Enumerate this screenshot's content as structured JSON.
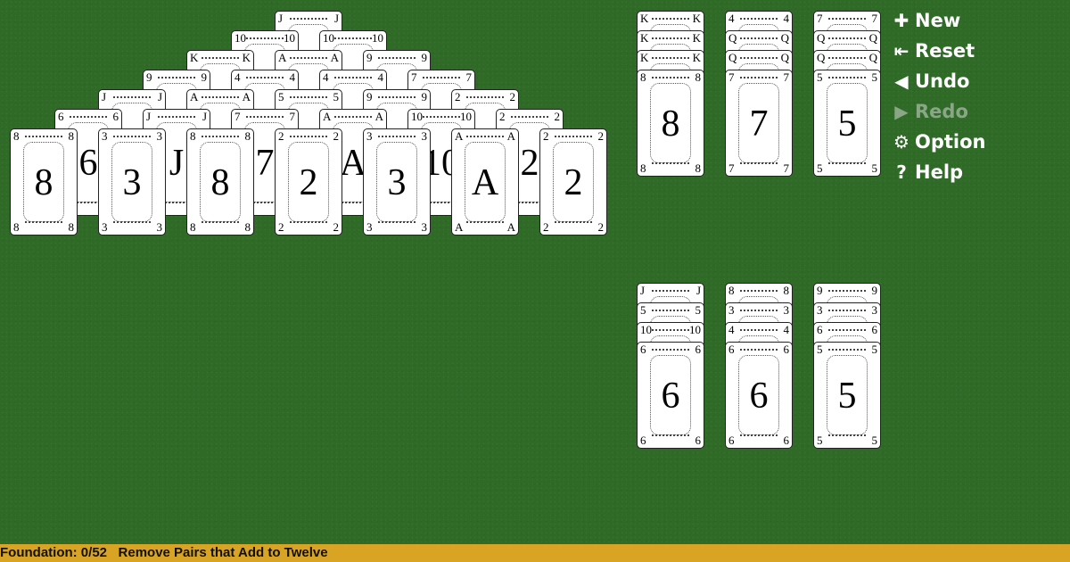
{
  "colors": {
    "felt": "#2f6a27",
    "status_bar": "#d9a423",
    "menu_text": "#ffffff",
    "menu_disabled": "#8aa687"
  },
  "pyramid": {
    "rows": [
      [
        "J"
      ],
      [
        "10",
        "10"
      ],
      [
        "K",
        "A",
        "9"
      ],
      [
        "9",
        "4",
        "4",
        "7"
      ],
      [
        "J",
        "A",
        "5",
        "9",
        "2"
      ],
      [
        "6",
        "J",
        "7",
        "A",
        "10",
        "2"
      ],
      [
        "8",
        "3",
        "8",
        "2",
        "3",
        "A",
        "2"
      ]
    ]
  },
  "top_piles": [
    {
      "cards": [
        "K",
        "K",
        "K",
        "8"
      ]
    },
    {
      "cards": [
        "4",
        "Q",
        "Q",
        "7"
      ]
    },
    {
      "cards": [
        "7",
        "Q",
        "Q",
        "5"
      ]
    }
  ],
  "bottom_piles": [
    {
      "cards": [
        "J",
        "5",
        "10",
        "6"
      ]
    },
    {
      "cards": [
        "8",
        "3",
        "4",
        "6"
      ]
    },
    {
      "cards": [
        "9",
        "3",
        "6",
        "5"
      ]
    }
  ],
  "menu": [
    {
      "name": "new",
      "icon": "plus-icon",
      "glyph": "✚",
      "label": "New",
      "enabled": true
    },
    {
      "name": "reset",
      "icon": "reset-icon",
      "glyph": "⇤",
      "label": "Reset",
      "enabled": true
    },
    {
      "name": "undo",
      "icon": "undo-icon",
      "glyph": "◀",
      "label": "Undo",
      "enabled": true
    },
    {
      "name": "redo",
      "icon": "redo-icon",
      "glyph": "▶",
      "label": "Redo",
      "enabled": false
    },
    {
      "name": "option",
      "icon": "gear-icon",
      "glyph": "⚙",
      "label": "Option",
      "enabled": true
    },
    {
      "name": "help",
      "icon": "help-icon",
      "glyph": "?",
      "label": "Help",
      "enabled": true
    }
  ],
  "status": {
    "foundation": "Foundation: 0/52",
    "instructions": "Remove Pairs that Add to Twelve"
  }
}
